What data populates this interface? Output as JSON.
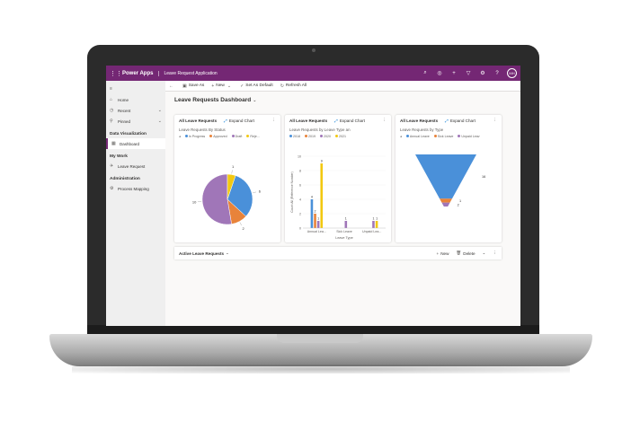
{
  "app": {
    "brand": "Power Apps",
    "app_name": "Leave Request Application",
    "avatar": "MH",
    "header_icons": [
      "search-icon",
      "lightbulb-icon",
      "plus-icon",
      "filter-icon",
      "gear-icon",
      "help-icon"
    ]
  },
  "colors": {
    "header": "#742774",
    "in_progress": "#4a90d9",
    "approved": "#e8833a",
    "draft": "#a076b8",
    "rejected": "#f2c811",
    "y2018": "#4a90d9",
    "y2019": "#e8833a",
    "y2020": "#a076b8",
    "y2021": "#f2c811"
  },
  "sidebar": {
    "items": [
      {
        "label": "Home",
        "icon": "home-icon"
      },
      {
        "label": "Recent",
        "icon": "clock-icon",
        "expand": "⌄"
      },
      {
        "label": "Pinned",
        "icon": "pin-icon",
        "expand": "⌄"
      }
    ],
    "sections": [
      {
        "title": "Data Visualization",
        "items": [
          {
            "label": "Dashboard",
            "icon": "dashboard-icon"
          }
        ]
      },
      {
        "title": "My Work",
        "items": [
          {
            "label": "Leave Request",
            "icon": "leave-icon"
          }
        ]
      },
      {
        "title": "Administration",
        "items": [
          {
            "label": "Process Mapping",
            "icon": "process-icon"
          }
        ]
      }
    ]
  },
  "cmdbar": {
    "save_as": "Save As",
    "new": "New",
    "set_default": "Set As Default",
    "refresh": "Refresh All"
  },
  "dashboard": {
    "title": "Leave Requests Dashboard"
  },
  "cards": [
    {
      "view": "All Leave Requests",
      "expand": "Expand Chart",
      "chart_title": "Leave Requests By Status",
      "legend": [
        "In Progress",
        "Approved",
        "Draft",
        "Reje..."
      ]
    },
    {
      "view": "All Leave Requests",
      "expand": "Expand Chart",
      "chart_title": "Leave Requests by Leave Type an",
      "legend": [
        "2018",
        "2019",
        "2020",
        "2021"
      ]
    },
    {
      "view": "All Leave Requests",
      "expand": "Expand Chart",
      "chart_title": "Leave Requests by Type",
      "legend": [
        "Annual Leave",
        "Sick Leave",
        "Unpaid Leav"
      ]
    }
  ],
  "chart_data": [
    {
      "type": "pie",
      "title": "Leave Requests By Status",
      "categories": [
        "In Progress",
        "Approved",
        "Draft",
        "Rejected"
      ],
      "values": [
        6,
        2,
        10,
        1
      ],
      "labels": [
        "6",
        "2",
        "10",
        "1"
      ]
    },
    {
      "type": "bar",
      "title": "Leave Requests by Leave Type an",
      "categories": [
        "Annual Lea...",
        "Sick Leave",
        "Unpaid Lea..."
      ],
      "xlabel": "Leave Type",
      "ylabel": "Count:All (Reference Number)",
      "ylim": [
        0,
        10
      ],
      "yticks": [
        "0",
        "2",
        "4",
        "6",
        "8",
        "10"
      ],
      "series": [
        {
          "name": "2018",
          "values": [
            4,
            0,
            0
          ]
        },
        {
          "name": "2019",
          "values": [
            2,
            0,
            0
          ]
        },
        {
          "name": "2020",
          "values": [
            1,
            1,
            1
          ]
        },
        {
          "name": "2021",
          "values": [
            9,
            0,
            1
          ]
        }
      ],
      "data_labels": [
        [
          "4",
          "",
          ""
        ],
        [
          "2",
          "",
          ""
        ],
        [
          "1",
          "1",
          "1"
        ],
        [
          "9",
          "",
          "1"
        ]
      ]
    },
    {
      "type": "funnel",
      "title": "Leave Requests by Type",
      "categories": [
        "Annual Leave",
        "Sick Leave",
        "Unpaid Leave"
      ],
      "values": [
        16,
        1,
        2
      ],
      "labels": [
        "16",
        "1",
        "2"
      ]
    }
  ],
  "active": {
    "title": "Active Leave Requests",
    "new": "New",
    "delete": "Delete"
  }
}
